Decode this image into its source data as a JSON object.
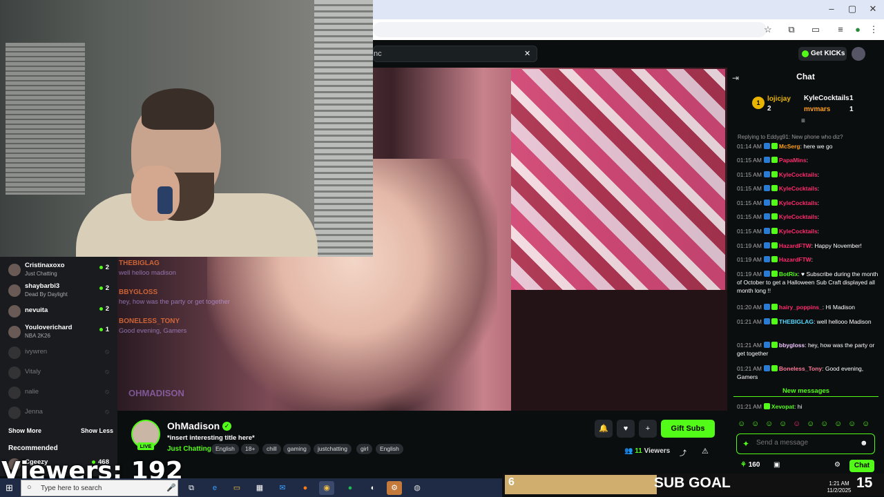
{
  "browser": {
    "search_text": "nc",
    "window_controls": {
      "minimize": "–",
      "maximize": "▢",
      "close": "✕"
    }
  },
  "header": {
    "get_kicks_label": "Get KICKs"
  },
  "sidebar": {
    "following": [
      {
        "name": "Cristinaxoxo",
        "subtitle": "Just Chatting",
        "count": "2"
      },
      {
        "name": "shaybarbi3",
        "subtitle": "Dead By Daylight",
        "count": "2"
      },
      {
        "name": "nevuita",
        "subtitle": "",
        "count": "2"
      },
      {
        "name": "Youloverichard",
        "subtitle": "NBA 2K26",
        "count": "1"
      }
    ],
    "offline": [
      "ivywren",
      "Vitaly",
      "nalie",
      "Jenna"
    ],
    "show_more": "Show More",
    "show_less": "Show Less",
    "recommended_label": "Recommended",
    "recommended": [
      {
        "name": "Cgeezy",
        "count": "468"
      }
    ]
  },
  "video_overlay": {
    "messages": [
      {
        "user": "THEBIGLAG",
        "text": "well helloo madison"
      },
      {
        "user": "BBYGLOSS",
        "text": "hey, how was the party or get together"
      },
      {
        "user": "BONELESS_TONY",
        "text": "Good evening, Gamers"
      }
    ],
    "brand_text": "OHMADISON"
  },
  "stream": {
    "streamer": "OhMadison",
    "live": "LIVE",
    "title": "*insert interesting title here*",
    "category": "Just Chatting",
    "tags": [
      "English",
      "18+",
      "chill",
      "gaming",
      "justchatting",
      "girl",
      "English"
    ],
    "gift_subs": "Gift Subs",
    "viewers_number": "11",
    "viewers_label": "Viewers"
  },
  "chat": {
    "title": "Chat",
    "leaderboard": [
      {
        "rank": "1",
        "user": "lojicjay",
        "count": "2"
      },
      {
        "user": "KyleCocktails",
        "count": "1"
      },
      {
        "user": "mvmars",
        "count": "1"
      }
    ],
    "reply_note": "Replying to Eddyg91: New phone who diz?",
    "messages": [
      {
        "time": "01:14 AM",
        "user": "McSerg",
        "color": "#ff9f1a",
        "text": ": here we go"
      },
      {
        "time": "01:15 AM",
        "user": "PapaMins",
        "color": "#ff2a6d",
        "text": ":"
      },
      {
        "time": "01:15 AM",
        "user": "KyleCocktails",
        "color": "#ff2a6d",
        "text": ":"
      },
      {
        "time": "01:15 AM",
        "user": "KyleCocktails",
        "color": "#ff2a6d",
        "text": ":"
      },
      {
        "time": "01:15 AM",
        "user": "KyleCocktails",
        "color": "#ff2a6d",
        "text": ":"
      },
      {
        "time": "01:15 AM",
        "user": "KyleCocktails",
        "color": "#ff2a6d",
        "text": ":"
      },
      {
        "time": "01:15 AM",
        "user": "KyleCocktails",
        "color": "#ff2a6d",
        "text": ":"
      },
      {
        "time": "01:19 AM",
        "user": "HazardFTW",
        "color": "#ff2a6d",
        "text": ": Happy November!"
      },
      {
        "time": "01:19 AM",
        "user": "HazardFTW",
        "color": "#ff2a6d",
        "text": ":"
      },
      {
        "time": "01:19 AM",
        "user": "BotRix",
        "color": "#53fc18",
        "text": ": ♥ Subscribe during the month of October to get a Halloween Sub Craft displayed all month long !!"
      },
      {
        "time": "01:20 AM",
        "user": "hairy_poppins_",
        "color": "#ff2a6d",
        "text": ": Hi Madison"
      },
      {
        "time": "01:21 AM",
        "user": "THEBIGLAG",
        "color": "#53d8fc",
        "text": ": well hellooo Madison"
      },
      {
        "time": "01:21 AM",
        "user": "bbygloss",
        "color": "#f0c4ff",
        "text": ": hey, how was the party or get together"
      },
      {
        "time": "01:21 AM",
        "user": "Boneless_Tony",
        "color": "#ff7a9a",
        "text": ": Good evening, Gamers"
      }
    ],
    "new_messages": "New messages",
    "latest": {
      "time": "01:21 AM",
      "user": "Xevopat",
      "color": "#53fc18",
      "text": ": hi"
    },
    "input_placeholder": "Send a message",
    "points": "160",
    "send_label": "Chat"
  },
  "overlays": {
    "viewers_text": "Viewers: 192",
    "subgoal_current": "6",
    "subgoal_label": "SUB GOAL",
    "subgoal_target": "15",
    "subgoal_progress": 0.4
  },
  "taskbar": {
    "search_placeholder": "Type here to search",
    "time": "1:21 AM",
    "date": "11/2/2025"
  }
}
